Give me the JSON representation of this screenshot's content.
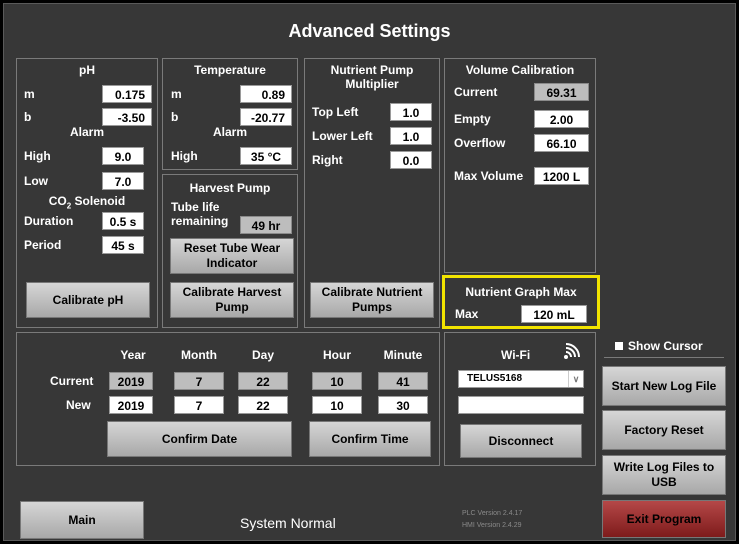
{
  "title": "Advanced Settings",
  "ph": {
    "header": "pH",
    "m_label": "m",
    "m_value": "0.175",
    "b_label": "b",
    "b_value": "-3.50",
    "alarm_label": "Alarm",
    "high_label": "High",
    "high_value": "9.0",
    "low_label": "Low",
    "low_value": "7.0",
    "co2_label": "CO",
    "co2_sub": "2",
    "co2_suffix": " Solenoid",
    "duration_label": "Duration",
    "duration_value": "0.5 s",
    "period_label": "Period",
    "period_value": "45 s",
    "calibrate_button": "Calibrate pH"
  },
  "temperature": {
    "header": "Temperature",
    "m_label": "m",
    "m_value": "0.89",
    "b_label": "b",
    "b_value": "-20.77",
    "alarm_label": "Alarm",
    "high_label": "High",
    "high_value": "35 °C"
  },
  "harvest": {
    "header": "Harvest Pump",
    "tube_life_label_1": "Tube life",
    "tube_life_label_2": "remaining",
    "tube_life_value": "49 hr",
    "reset_button_line1": "Reset Tube Wear",
    "reset_button_line2": "Indicator",
    "calibrate_button_line1": "Calibrate Harvest",
    "calibrate_button_line2": "Pump"
  },
  "nutrient": {
    "header_line1": "Nutrient Pump",
    "header_line2": "Multiplier",
    "top_left_label": "Top Left",
    "top_left_value": "1.0",
    "lower_left_label": "Lower Left",
    "lower_left_value": "1.0",
    "right_label": "Right",
    "right_value": "0.0",
    "calibrate_button_line1": "Calibrate Nutrient",
    "calibrate_button_line2": "Pumps"
  },
  "volume": {
    "header": "Volume Calibration",
    "current_label": "Current",
    "current_value": "69.31",
    "empty_label": "Empty",
    "empty_value": "2.00",
    "overflow_label": "Overflow",
    "overflow_value": "66.10",
    "max_volume_label": "Max Volume",
    "max_volume_value": "1200 L"
  },
  "graph": {
    "header": "Nutrient Graph Max",
    "max_label": "Max",
    "max_value": "120 mL"
  },
  "datetime": {
    "col_year": "Year",
    "col_month": "Month",
    "col_day": "Day",
    "col_hour": "Hour",
    "col_minute": "Minute",
    "current_label": "Current",
    "current_year": "2019",
    "current_month": "7",
    "current_day": "22",
    "current_hour": "10",
    "current_minute": "41",
    "new_label": "New",
    "new_year": "2019",
    "new_month": "7",
    "new_day": "22",
    "new_hour": "10",
    "new_minute": "30",
    "confirm_date_button": "Confirm Date",
    "confirm_time_button": "Confirm Time"
  },
  "wifi": {
    "label": "Wi-Fi",
    "icon": "wifi-icon",
    "network": "TELUS5168",
    "password": "",
    "disconnect_button": "Disconnect"
  },
  "right_panel": {
    "show_cursor_label": "Show Cursor",
    "show_cursor_checked": false,
    "start_log_button": "Start New Log File",
    "factory_reset_button": "Factory Reset",
    "write_log_line1": "Write Log Files to",
    "write_log_line2": "USB",
    "exit_button": "Exit Program"
  },
  "footer": {
    "main_button": "Main",
    "status": "System Normal",
    "plc_version": "PLC Version 2.4.17",
    "hmi_version": "HMI Version 2.4.29"
  },
  "colors": {
    "background": "#373737",
    "highlight": "#f2e400",
    "exit_button": "#9a2b2b"
  }
}
